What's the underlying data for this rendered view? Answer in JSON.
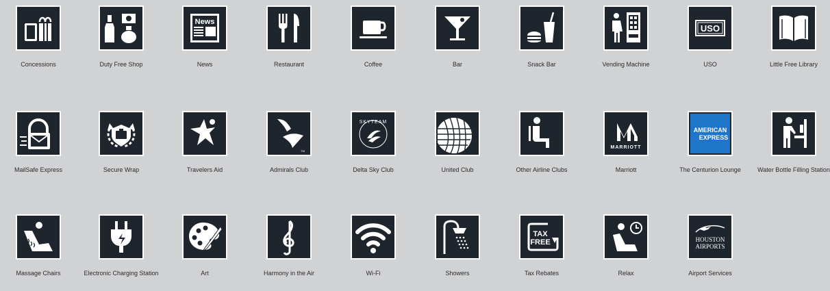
{
  "rows": [
    {
      "items": [
        {
          "icon": "concessions-icon",
          "label": "Concessions"
        },
        {
          "icon": "duty-free-shop-icon",
          "label": "Duty Free Shop"
        },
        {
          "icon": "news-icon",
          "label": "News",
          "badge": "News"
        },
        {
          "icon": "restaurant-icon",
          "label": "Restaurant"
        },
        {
          "icon": "coffee-icon",
          "label": "Coffee"
        },
        {
          "icon": "bar-icon",
          "label": "Bar"
        },
        {
          "icon": "snack-bar-icon",
          "label": "Snack Bar"
        },
        {
          "icon": "vending-machine-icon",
          "label": "Vending Machine"
        },
        {
          "icon": "uso-icon",
          "label": "USO",
          "badge": "USO"
        },
        {
          "icon": "little-free-library-icon",
          "label": "Little Free Library"
        }
      ]
    },
    {
      "items": [
        {
          "icon": "mailsafe-express-icon",
          "label": "MailSafe Express"
        },
        {
          "icon": "secure-wrap-icon",
          "label": "Secure Wrap"
        },
        {
          "icon": "travelers-aid-icon",
          "label": "Travelers Aid"
        },
        {
          "icon": "admirals-club-icon",
          "label": "Admirals Club",
          "badge": "TM"
        },
        {
          "icon": "delta-sky-club-icon",
          "label": "Delta Sky Club",
          "badge": "SKYTEAM"
        },
        {
          "icon": "united-club-icon",
          "label": "United Club"
        },
        {
          "icon": "other-airline-clubs-icon",
          "label": "Other Airline Clubs"
        },
        {
          "icon": "marriott-icon",
          "label": "Marriott",
          "badge": "MARRIOTT"
        },
        {
          "icon": "american-express-icon",
          "label": "The Centurion Lounge",
          "badge": "AMERICAN EXPRESS"
        },
        {
          "icon": "water-bottle-filling-station-icon",
          "label": "Water Bottle Filling Station"
        }
      ]
    },
    {
      "items": [
        {
          "icon": "massage-chairs-icon",
          "label": "Massage Chairs"
        },
        {
          "icon": "electronic-charging-station-icon",
          "label": "Electronic Charging Station"
        },
        {
          "icon": "art-icon",
          "label": "Art"
        },
        {
          "icon": "harmony-in-the-air-icon",
          "label": "Harmony in the Air"
        },
        {
          "icon": "wifi-icon",
          "label": "Wi-Fi"
        },
        {
          "icon": "showers-icon",
          "label": "Showers"
        },
        {
          "icon": "tax-rebates-icon",
          "label": "Tax Rebates",
          "badge": "TAX FREE"
        },
        {
          "icon": "relax-icon",
          "label": "Relax"
        },
        {
          "icon": "houston-airports-icon",
          "label": "Airport Services",
          "badge": "HOUSTON AIRPORTS"
        }
      ]
    }
  ],
  "colors": {
    "background": "#d1d2d4",
    "tile": "#1e252d",
    "tile_border": "#ffffff",
    "glyph": "#ffffff",
    "amex_blue": "#1f75c9",
    "label": "#2b2b2b"
  }
}
